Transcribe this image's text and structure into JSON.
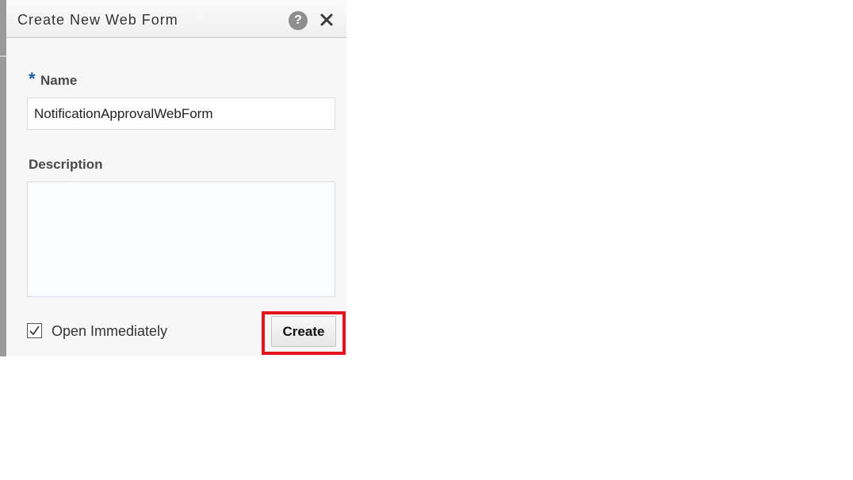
{
  "dialog": {
    "title": "Create New Web Form",
    "help_icon": "help-icon",
    "help_glyph": "?",
    "close_icon": "close-icon"
  },
  "form": {
    "name": {
      "required_marker": "*",
      "label": "Name",
      "value": "NotificationApprovalWebForm"
    },
    "description": {
      "label": "Description",
      "value": ""
    },
    "open_immediately": {
      "label": "Open Immediately",
      "checked": true
    },
    "create_label": "Create"
  },
  "colors": {
    "highlight": "#e3141d",
    "required_star": "#1f5fa8"
  }
}
